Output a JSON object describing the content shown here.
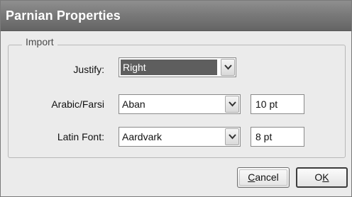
{
  "window": {
    "title": "Parnian Properties"
  },
  "group": {
    "label": "Import"
  },
  "justify": {
    "label": "Justify:",
    "value": "Right"
  },
  "arabic": {
    "label": "Arabic/Farsi",
    "font": "Aban",
    "size": "10 pt"
  },
  "latin": {
    "label": "Latin Font:",
    "font": "Aardvark",
    "size": "8 pt"
  },
  "buttons": {
    "cancel_mnemonic": "C",
    "cancel_rest": "ancel",
    "ok_first": "O",
    "ok_mnemonic": "K"
  },
  "icons": {
    "dropdown": "chevron-down-icon"
  }
}
